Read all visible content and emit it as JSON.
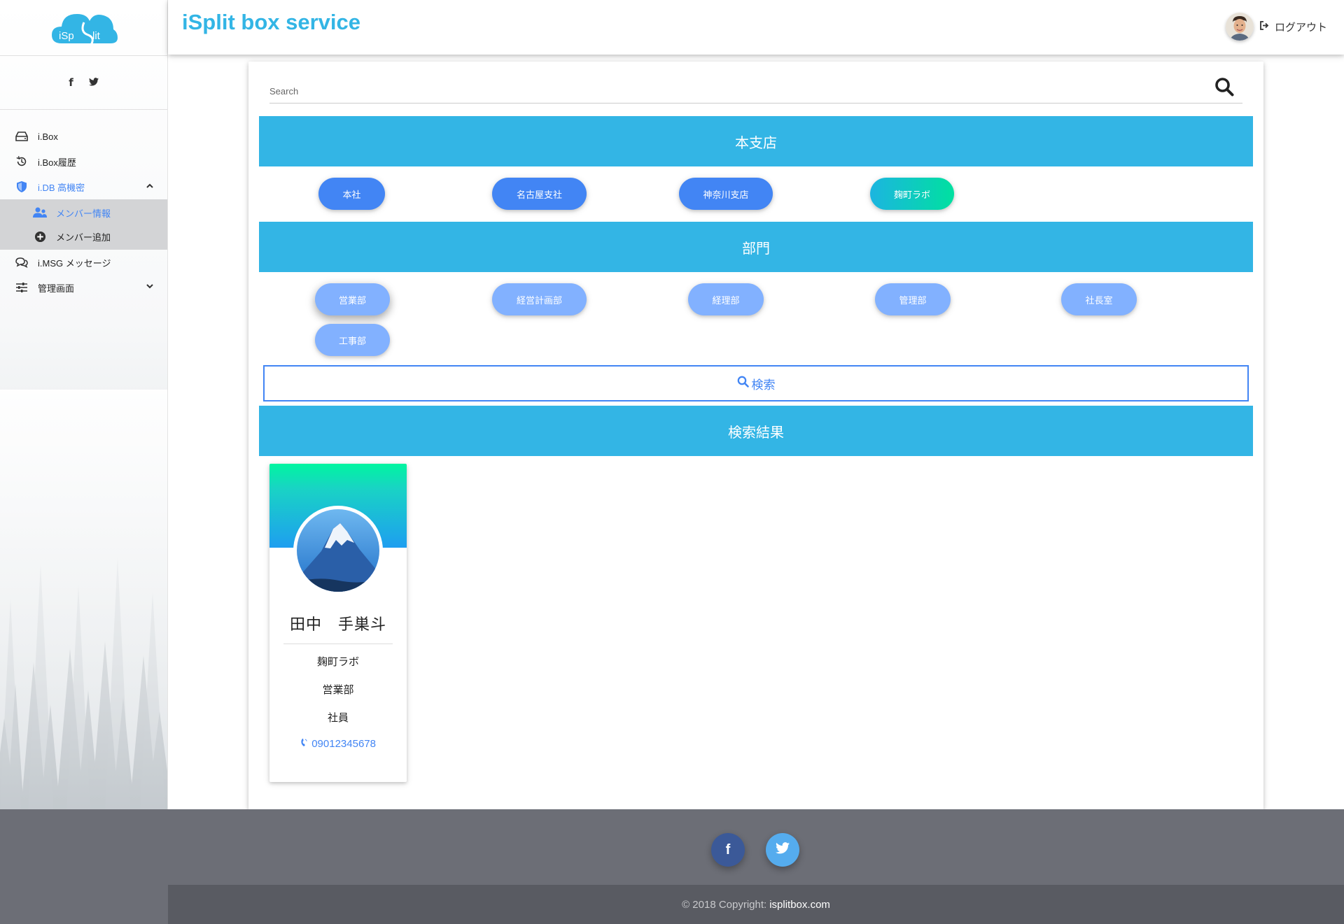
{
  "header": {
    "brand": "iSplit box service",
    "logout_label": "ログアウト"
  },
  "sidebar": {
    "logo_text_left": "iSp",
    "logo_text_right": "lit",
    "social": {
      "facebook": "f",
      "twitter": "t"
    },
    "items": [
      {
        "label": "i.Box",
        "icon": "hdd-icon"
      },
      {
        "label": "i.Box履歴",
        "icon": "history-icon"
      },
      {
        "label": "i.DB 高機密",
        "icon": "shield-icon",
        "expanded": true
      },
      {
        "label": "i.MSG メッセージ",
        "icon": "chat-icon"
      },
      {
        "label": "管理画面",
        "icon": "sliders-icon"
      }
    ],
    "sub_items": [
      {
        "label": "メンバー情報",
        "icon": "users-icon"
      },
      {
        "label": "メンバー追加",
        "icon": "plus-circle-icon"
      }
    ]
  },
  "search": {
    "placeholder": "Search"
  },
  "branches": {
    "title": "本支店",
    "items": [
      "本社",
      "名古屋支社",
      "神奈川支店",
      "麹町ラボ"
    ],
    "selected": "麹町ラボ"
  },
  "departments": {
    "title": "部門",
    "items": [
      "営業部",
      "経営計画部",
      "経理部",
      "管理部",
      "社長室",
      "工事部"
    ],
    "selected": "営業部"
  },
  "search_button": {
    "label": "検索"
  },
  "results": {
    "title": "検索結果",
    "cards": [
      {
        "name": "田中　手巣斗",
        "branch": "麹町ラボ",
        "department": "営業部",
        "position": "社員",
        "phone": "09012345678"
      }
    ]
  },
  "footer": {
    "copyright_prefix": "© 2018 Copyright:",
    "copyright_link": "isplitbox.com"
  },
  "colors": {
    "accent": "#33b5e5",
    "primary": "#4285f4",
    "light_primary": "#82b1ff",
    "footer": "#6c6e76",
    "footer_bottom": "#595b62"
  }
}
